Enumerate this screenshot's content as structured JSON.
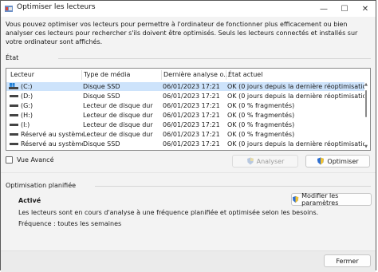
{
  "window": {
    "title": "Optimiser les lecteurs"
  },
  "description": "Vous pouvez optimiser vos lecteurs pour permettre à l'ordinateur de fonctionner plus efficacement ou bien analyser ces lecteurs pour rechercher s'ils doivent être optimisés. Seuls les lecteurs connectés et installés sur votre ordinateur sont affichés.",
  "status_section": {
    "label": "État",
    "columns": [
      "Lecteur",
      "Type de média",
      "Dernière analyse o...",
      "État actuel"
    ],
    "rows": [
      {
        "drive": "(C:)",
        "media": "Disque SSD",
        "last": "06/01/2023 17:21",
        "state": "OK (0 jours depuis la dernière réoptimisatio",
        "selected": true,
        "icon": "system-drive-icon"
      },
      {
        "drive": "(D:)",
        "media": "Disque SSD",
        "last": "06/01/2023 17:21",
        "state": "OK (0 jours depuis la dernière réoptimisatio",
        "selected": false,
        "icon": "drive-icon"
      },
      {
        "drive": "(G:)",
        "media": "Lecteur de disque dur",
        "last": "06/01/2023 17:21",
        "state": "OK (0 % fragmentés)",
        "selected": false,
        "icon": "drive-icon"
      },
      {
        "drive": "(H:)",
        "media": "Lecteur de disque dur",
        "last": "06/01/2023 17:21",
        "state": "OK (0 % fragmentés)",
        "selected": false,
        "icon": "drive-icon"
      },
      {
        "drive": "(I:)",
        "media": "Lecteur de disque dur",
        "last": "06/01/2023 17:21",
        "state": "OK (0 % fragmentés)",
        "selected": false,
        "icon": "drive-icon"
      },
      {
        "drive": "Réservé au système",
        "media": "Lecteur de disque dur",
        "last": "06/01/2023 17:21",
        "state": "OK (0 % fragmentés)",
        "selected": false,
        "icon": "drive-icon"
      },
      {
        "drive": "Réservé au système",
        "media": "Disque SSD",
        "last": "06/01/2023 17:21",
        "state": "OK (0 jours depuis la dernière réoptimisatio",
        "selected": false,
        "icon": "drive-icon"
      }
    ]
  },
  "advanced_view": {
    "label": "Vue Avancé",
    "checked": false
  },
  "buttons": {
    "analyze": "Analyser",
    "optimize": "Optimiser",
    "change_settings": "Modifier les paramètres",
    "close": "Fermer"
  },
  "schedule": {
    "label": "Optimisation planifiée",
    "status": "Activé",
    "info": "Les lecteurs sont en cours d'analyse à une fréquence planifiée et optimisée selon les besoins.",
    "frequency": "Fréquence : toutes les semaines"
  },
  "colors": {
    "selection": "#cde3fb",
    "shield_blue": "#2f6fd1",
    "shield_yellow": "#f2c230"
  }
}
